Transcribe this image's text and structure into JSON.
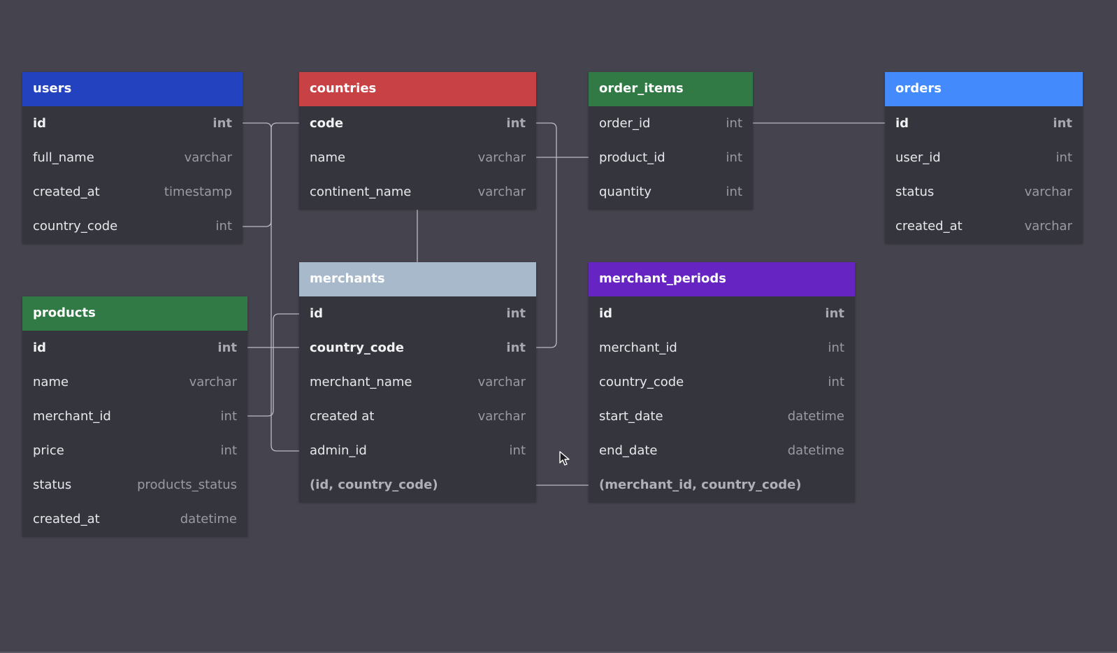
{
  "colors": {
    "background": "#45434d",
    "table_body": "#35363d",
    "connector": "#bcbcc6"
  },
  "tables": {
    "users": {
      "name": "users",
      "header_color": "#2342c0",
      "fields": [
        {
          "name": "id",
          "type": "int"
        },
        {
          "name": "full_name",
          "type": "varchar"
        },
        {
          "name": "created_at",
          "type": "timestamp"
        },
        {
          "name": "country_code",
          "type": "int"
        }
      ]
    },
    "countries": {
      "name": "countries",
      "header_color": "#c84145",
      "fields": [
        {
          "name": "code",
          "type": "int"
        },
        {
          "name": "name",
          "type": "varchar"
        },
        {
          "name": "continent_name",
          "type": "varchar"
        }
      ]
    },
    "order_items": {
      "name": "order_items",
      "header_color": "#327a45",
      "fields": [
        {
          "name": "order_id",
          "type": "int"
        },
        {
          "name": "product_id",
          "type": "int"
        },
        {
          "name": "quantity",
          "type": "int"
        }
      ]
    },
    "orders": {
      "name": "orders",
      "header_color": "#438bfc",
      "fields": [
        {
          "name": "id",
          "type": "int"
        },
        {
          "name": "user_id",
          "type": "int"
        },
        {
          "name": "status",
          "type": "varchar"
        },
        {
          "name": "created_at",
          "type": "varchar"
        }
      ]
    },
    "products": {
      "name": "products",
      "header_color": "#327a45",
      "fields": [
        {
          "name": "id",
          "type": "int"
        },
        {
          "name": "name",
          "type": "varchar"
        },
        {
          "name": "merchant_id",
          "type": "int"
        },
        {
          "name": "price",
          "type": "int"
        },
        {
          "name": "status",
          "type": "products_status"
        },
        {
          "name": "created_at",
          "type": "datetime"
        }
      ]
    },
    "merchants": {
      "name": "merchants",
      "header_color": "#a8b9cc",
      "fields": [
        {
          "name": "id",
          "type": "int"
        },
        {
          "name": "country_code",
          "type": "int"
        },
        {
          "name": "merchant_name",
          "type": "varchar"
        },
        {
          "name": "created at",
          "type": "varchar"
        },
        {
          "name": "admin_id",
          "type": "int"
        }
      ],
      "index_label": "(id, country_code)"
    },
    "merchant_periods": {
      "name": "merchant_periods",
      "header_color": "#6624c2",
      "fields": [
        {
          "name": "id",
          "type": "int"
        },
        {
          "name": "merchant_id",
          "type": "int"
        },
        {
          "name": "country_code",
          "type": "int"
        },
        {
          "name": "start_date",
          "type": "datetime"
        },
        {
          "name": "end_date",
          "type": "datetime"
        }
      ],
      "index_label": "(merchant_id, country_code)"
    }
  },
  "relationships": [
    {
      "from": "users.id",
      "to": "merchants.admin_id"
    },
    {
      "from": "users.country_code",
      "to": "countries.code"
    },
    {
      "from": "countries.code",
      "to": "merchants.country_code"
    },
    {
      "from": "countries.name",
      "to": "order_items.product_id"
    },
    {
      "from": "countries",
      "to": "merchants"
    },
    {
      "from": "order_items.order_id",
      "to": "orders.id"
    },
    {
      "from": "products.id",
      "to": "merchants.country_code"
    },
    {
      "from": "products.merchant_id",
      "to": "merchants.id"
    },
    {
      "from": "merchants.(id, country_code)",
      "to": "merchant_periods.(merchant_id, country_code)"
    }
  ]
}
